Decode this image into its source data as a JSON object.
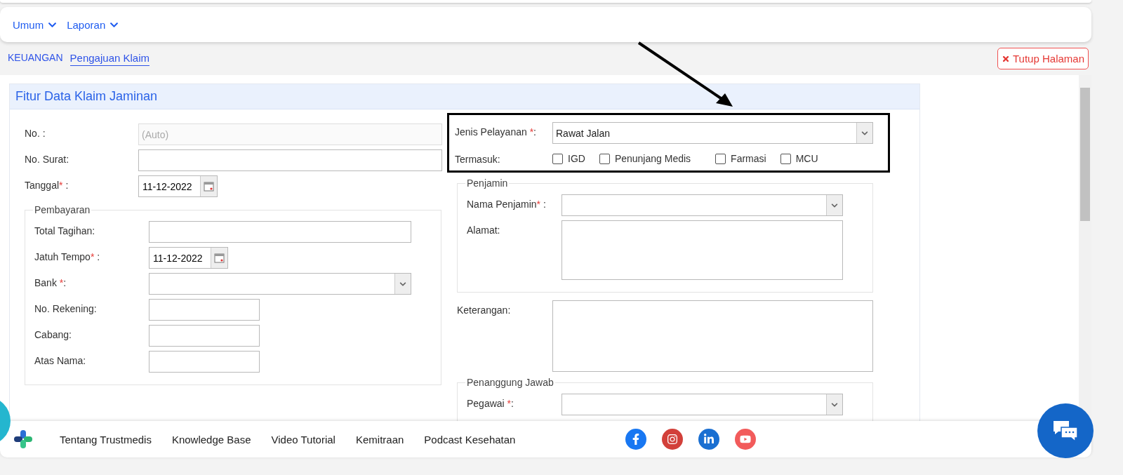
{
  "menu": [
    {
      "label": "Umum"
    },
    {
      "label": "Laporan"
    }
  ],
  "breadcrumb": [
    {
      "label": "KEUANGAN",
      "selected": false
    },
    {
      "label": "Pengajuan Klaim",
      "selected": true
    }
  ],
  "close_button": {
    "label": "Tutup Halaman"
  },
  "form": {
    "title": "Fitur Data Klaim Jaminan",
    "left": [
      {
        "kind": "text",
        "label": "No. :",
        "placeholder": "(Auto)"
      },
      {
        "kind": "text",
        "label": "No. Surat:"
      },
      {
        "kind": "date",
        "label": "Tanggal",
        "mark": "*",
        "after": " :",
        "value": "11-12-2022"
      },
      {
        "kind": "group",
        "title": "Pembayaran",
        "fields": [
          {
            "kind": "text",
            "label": "Total Tagihan:"
          },
          {
            "kind": "date",
            "label": "Jatuh Tempo",
            "mark": "*",
            "after": " :",
            "value": "11-12-2022"
          },
          {
            "kind": "select",
            "label": "Bank ",
            "mark": "*",
            "after": ":"
          },
          {
            "kind": "short",
            "label": "No. Rekening:"
          },
          {
            "kind": "short",
            "label": "Cabang:"
          },
          {
            "kind": "short",
            "label": "Atas Nama:"
          }
        ]
      }
    ],
    "highlighted": {
      "service": {
        "kind": "select",
        "label": "Jenis Pelayanan ",
        "mark": "*",
        "after": ":",
        "value": "Rawat Jalan"
      },
      "includes_label": "Termasuk:",
      "includes": [
        {
          "label": "IGD",
          "checked": false
        },
        {
          "label": "Penunjang Medis",
          "checked": false
        },
        {
          "label": "Farmasi",
          "checked": false
        },
        {
          "label": "MCU",
          "checked": false
        }
      ]
    },
    "right": [
      {
        "kind": "group",
        "title": "Penjamin",
        "fields": [
          {
            "kind": "select",
            "label": "Nama Penjamin",
            "mark": "*",
            "after": " :"
          },
          {
            "kind": "textarea",
            "label": "Alamat:"
          }
        ]
      },
      {
        "kind": "bigarea",
        "label": "Keterangan:"
      },
      {
        "kind": "group",
        "title": "Penanggung Jawab",
        "fields": [
          {
            "kind": "select",
            "label": "Pegawai ",
            "mark": "*",
            "after": ":"
          }
        ]
      }
    ]
  },
  "footer": {
    "links": [
      "Tentang Trustmedis",
      "Knowledge Base",
      "Video Tutorial",
      "Kemitraan",
      "Podcast Kesehatan"
    ],
    "social": [
      {
        "kind": "facebook",
        "color": "#1877f2"
      },
      {
        "kind": "instagram",
        "color": "#d2403a"
      },
      {
        "kind": "linkedin",
        "color": "#1a6fd1"
      },
      {
        "kind": "youtube",
        "color": "#f25b5b"
      }
    ]
  }
}
